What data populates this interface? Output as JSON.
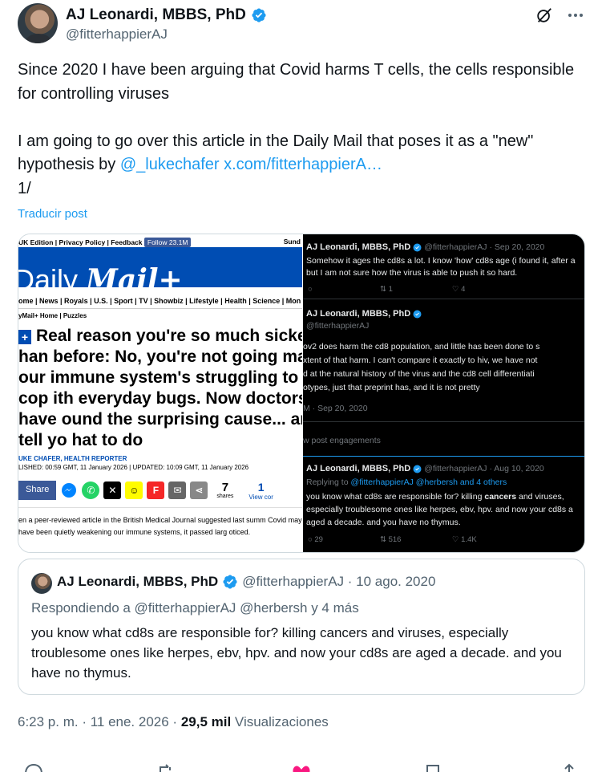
{
  "author": {
    "name": "AJ Leonardi, MBBS, PhD",
    "handle": "@fitterhappierAJ"
  },
  "header_icons": [
    "grok-icon",
    "more-icon"
  ],
  "tweet": {
    "line1": "Since 2020 I have been arguing that Covid harms T cells, the cells responsible for controlling viruses",
    "line2_prefix": "I am going to go over this article in the Daily Mail that poses it as a \"new\" hypothesis by ",
    "mention": "@_lukechafer",
    "url": "x.com/fitterhappierA…",
    "line3": "1/",
    "translate": "Traducir post"
  },
  "daily_mail": {
    "top_links": "UK Edition | Privacy Policy | Feedback",
    "follow": "Follow 23.1M",
    "sunday": "Sund",
    "logo": "Daily Mail+",
    "logo_prefix": "Daily ",
    "logo_main": "Mail+",
    "nav": "ome | News | Royals | U.S. | Sport | TV | Showbiz | Lifestyle | Health | Science | Mon",
    "sub_nav": "yMail+ Home | Puzzles",
    "plus_badge": "+",
    "headline_1": "Real reason you're so much sicker",
    "headline_rest": "han before: No, you're not going mad, our immune system's struggling to cop ith everyday bugs. Now doctors have ound the surprising cause... and tell yo hat to do",
    "author": "UKE CHAFER, HEALTH REPORTER",
    "dates": "LISHED: 00:59 GMT, 11 January 2026 | UPDATED: 10:09 GMT, 11 January 2026",
    "share": "Share",
    "shares_count": "7",
    "shares_label": "shares",
    "view_count": "1",
    "view_label": "View cor",
    "body": "en a peer-reviewed article in the British Medical Journal suggested last summ Covid may have been quietly weakening our immune systems, it passed larg oticed."
  },
  "dark_thread": {
    "t1": {
      "name": "AJ Leonardi, MBBS, PhD",
      "meta": "@fitterhappierAJ · Sep 20, 2020",
      "line1": "Somehow it ages the cd8s a lot. I know 'how' cd8s age (i found it, after a",
      "line2": "but I am not sure how the virus is able to push it so hard.",
      "replies": "",
      "retweets": "1",
      "likes": "4"
    },
    "t2": {
      "name": "AJ Leonardi, MBBS, PhD",
      "handle": "@fitterhappierAJ",
      "line1": "ov2 does harm the cd8 population, and little has been done to s",
      "line2": "xtent of that harm. I can't compare it exactly to hiv, we have not",
      "line3": "d at the natural history of the virus and the cd8 cell differentiati",
      "line4": "otypes, just that preprint has, and it is not pretty",
      "time": "M · Sep 20, 2020",
      "engagements": "w post engagements"
    },
    "t3": {
      "name": "AJ Leonardi, MBBS, PhD",
      "meta": "@fitterhappierAJ · Aug 10, 2020",
      "replying_prefix": "Replying to ",
      "replying_users": "@fitterhappierAJ @herbersh and 4 others",
      "line1_a": "you know what cd8s are responsible for? killing ",
      "line1_b": "cancers",
      "line1_c": " and viruses,",
      "line2": "especially troublesome ones like herpes, ebv, hpv. and now your cd8s a",
      "line3": "aged a decade. and you have no thymus.",
      "replies": "29",
      "retweets": "516",
      "likes": "1.4K"
    }
  },
  "quote": {
    "name": "AJ Leonardi, MBBS, PhD",
    "handle_date": "@fitterhappierAJ · 10 ago. 2020",
    "replying": "Respondiendo a @fitterhappierAJ @herbersh y 4 más",
    "text": "you know what cd8s are responsible for? killing cancers and viruses, especially troublesome ones like herpes, ebv, hpv. and now your cd8s are aged a decade. and you have no thymus."
  },
  "meta": {
    "time": "6:23 p. m. · 11 ene. 2026 · ",
    "views_count": "29,5 mil",
    "views_label": " Visualizaciones"
  },
  "colors": {
    "link": "#1d9bf0",
    "verified": "#1d9bf0",
    "like_active": "#f91880",
    "dm_blue": "#004db3"
  }
}
